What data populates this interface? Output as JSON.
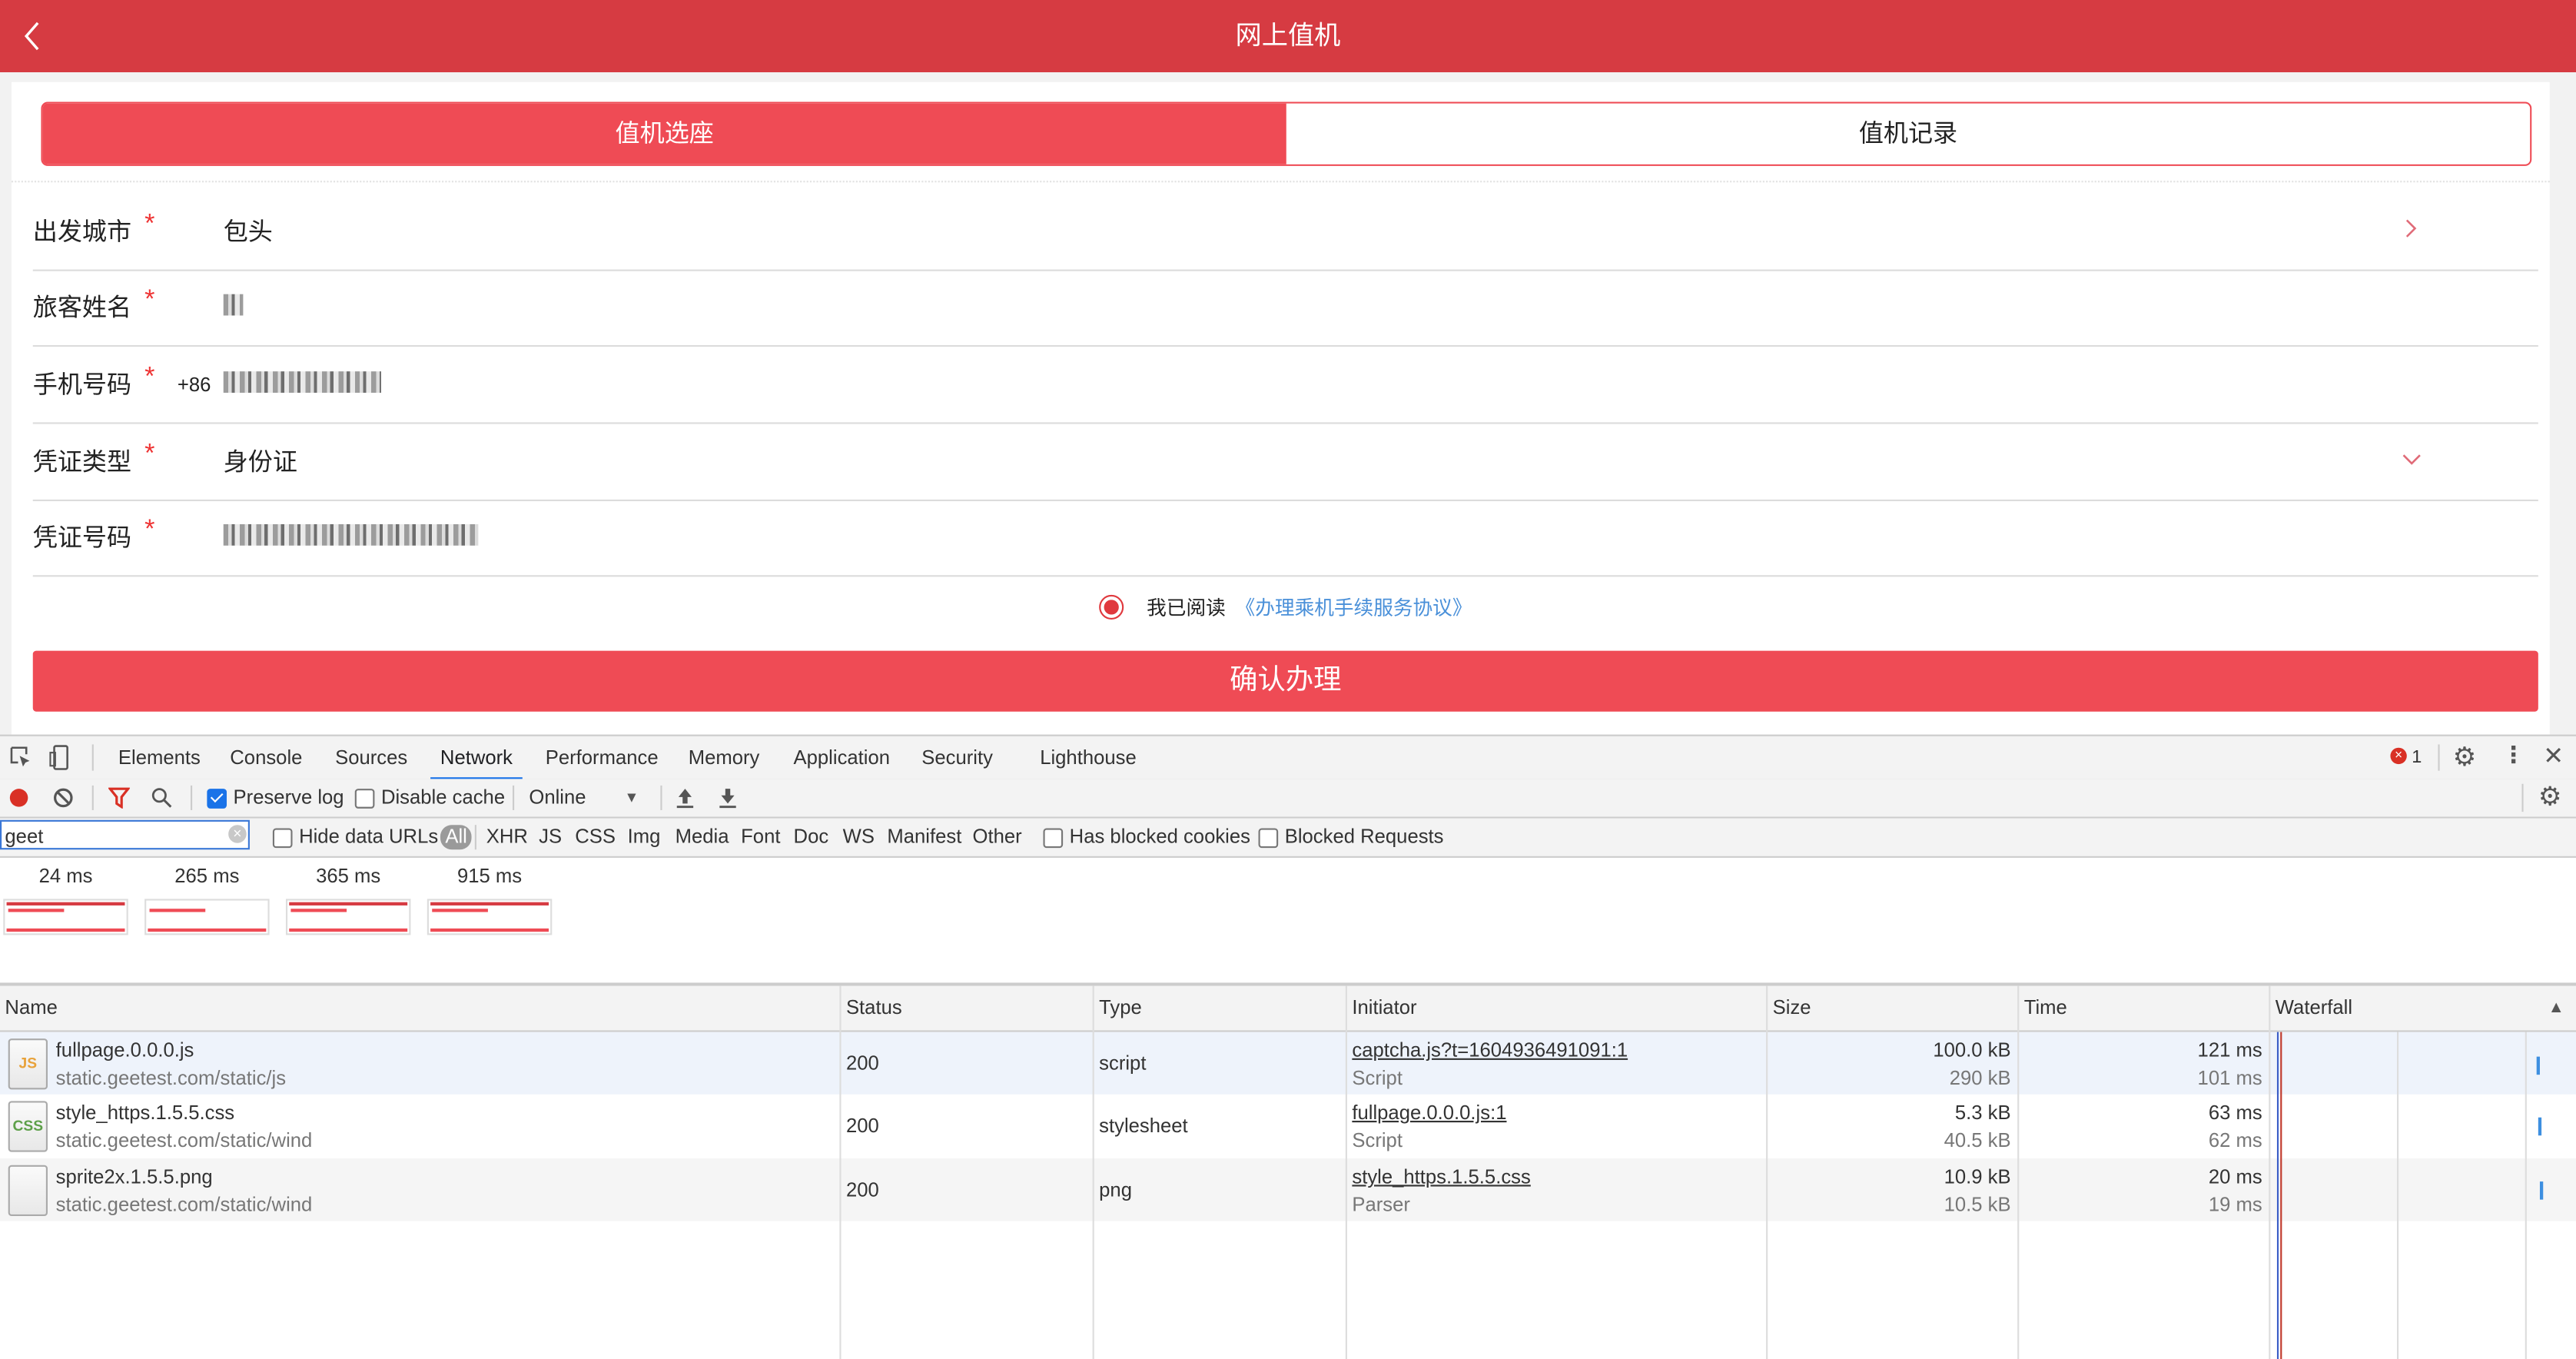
{
  "app": {
    "title": "网上值机",
    "tabs": [
      {
        "label": "值机选座",
        "active": true
      },
      {
        "label": "值机记录",
        "active": false
      }
    ],
    "form": [
      {
        "label": "出发城市",
        "required": "*",
        "value": "包头",
        "control": "chevron-right"
      },
      {
        "label": "旅客姓名",
        "required": "*",
        "value": "[redacted]",
        "control": "none"
      },
      {
        "label": "手机号码",
        "required": "*",
        "prefix": "+86",
        "value": "[redacted]",
        "control": "none"
      },
      {
        "label": "凭证类型",
        "required": "*",
        "value": "身份证",
        "control": "chevron-down"
      },
      {
        "label": "凭证号码",
        "required": "*",
        "value": "[redacted]",
        "control": "none"
      }
    ],
    "agreement": {
      "checked": true,
      "text": "我已阅读",
      "link": "《办理乘机手续服务协议》"
    },
    "confirm_label": "确认办理",
    "colors": {
      "header": "#d63b42",
      "accent": "#ef4b55",
      "link": "#4a90d9"
    }
  },
  "devtools": {
    "tabs": [
      "Elements",
      "Console",
      "Sources",
      "Network",
      "Performance",
      "Memory",
      "Application",
      "Security",
      "Lighthouse"
    ],
    "active_tab": "Network",
    "error_count": "1",
    "toolbar": {
      "preserve_log": {
        "label": "Preserve log",
        "checked": true
      },
      "disable_cache": {
        "label": "Disable cache",
        "checked": false
      },
      "throttling": "Online"
    },
    "filter": {
      "value": "geet",
      "hide_data_urls": {
        "label": "Hide data URLs",
        "checked": false
      },
      "types": [
        "All",
        "XHR",
        "JS",
        "CSS",
        "Img",
        "Media",
        "Font",
        "Doc",
        "WS",
        "Manifest",
        "Other"
      ],
      "active_type": "All",
      "has_blocked_cookies": {
        "label": "Has blocked cookies",
        "checked": false
      },
      "blocked_requests": {
        "label": "Blocked Requests",
        "checked": false
      }
    },
    "filmstrip": [
      "24 ms",
      "265 ms",
      "365 ms",
      "915 ms"
    ],
    "columns": [
      "Name",
      "Status",
      "Type",
      "Initiator",
      "Size",
      "Time",
      "Waterfall"
    ],
    "sort_indicator": "▲",
    "requests": [
      {
        "icon": "JS",
        "name": "fullpage.0.0.0.js",
        "path": "static.geetest.com/static/js",
        "status": "200",
        "type": "script",
        "initiator": "captcha.js?t=1604936491091:1",
        "initiator_type": "Script",
        "size": "100.0 kB",
        "resource_size": "290 kB",
        "time": "121 ms",
        "latency": "101 ms"
      },
      {
        "icon": "CSS",
        "name": "style_https.1.5.5.css",
        "path": "static.geetest.com/static/wind",
        "status": "200",
        "type": "stylesheet",
        "initiator": "fullpage.0.0.0.js:1",
        "initiator_type": "Script",
        "size": "5.3 kB",
        "resource_size": "40.5 kB",
        "time": "63 ms",
        "latency": "62 ms"
      },
      {
        "icon": "IMG",
        "name": "sprite2x.1.5.5.png",
        "path": "static.geetest.com/static/wind",
        "status": "200",
        "type": "png",
        "initiator": "style_https.1.5.5.css",
        "initiator_type": "Parser",
        "size": "10.9 kB",
        "resource_size": "10.5 kB",
        "time": "20 ms",
        "latency": "19 ms"
      }
    ]
  }
}
